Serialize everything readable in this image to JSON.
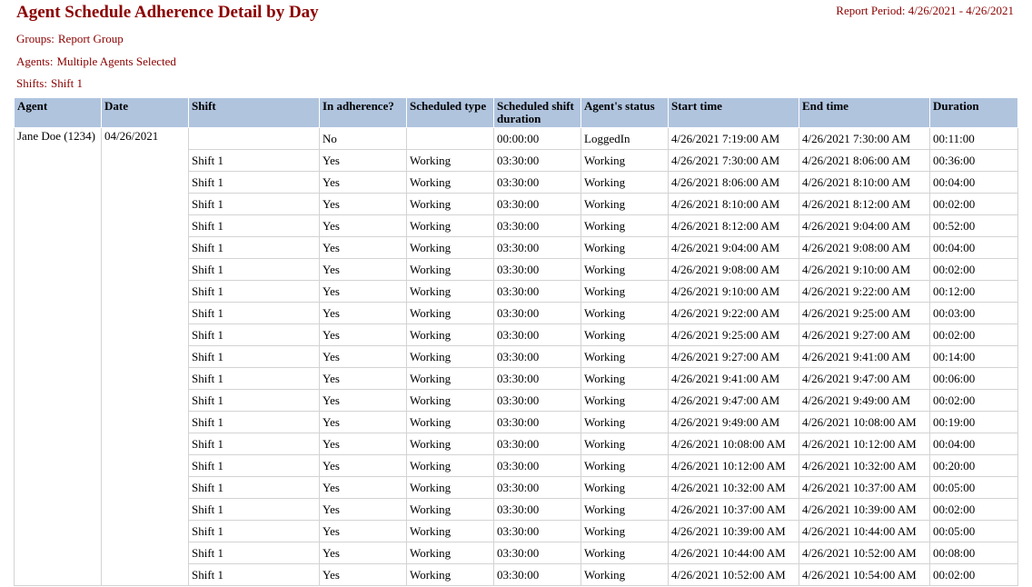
{
  "report": {
    "title": "Agent Schedule Adherence Detail by Day",
    "period_label": "Report Period:",
    "period_value": "4/26/2021 - 4/26/2021",
    "groups_label": "Groups:",
    "groups_value": "Report Group",
    "agents_label": "Agents:",
    "agents_value": "Multiple Agents Selected",
    "shifts_label": "Shifts:",
    "shifts_value": "Shift 1"
  },
  "table": {
    "headers": [
      "Agent",
      "Date",
      "Shift",
      "In adherence?",
      "Scheduled type",
      "Scheduled shift duration",
      "Agent's status",
      "Start time",
      "End time",
      "Duration"
    ],
    "agent": "Jane Doe (1234)",
    "date": "04/26/2021",
    "rows": [
      {
        "shift": "",
        "adherence": "No",
        "type": "",
        "sched_duration": "00:00:00",
        "status": "LoggedIn",
        "start": "4/26/2021 7:19:00 AM",
        "end": "4/26/2021 7:30:00 AM",
        "duration": "00:11:00"
      },
      {
        "shift": "Shift 1",
        "adherence": "Yes",
        "type": "Working",
        "sched_duration": "03:30:00",
        "status": "Working",
        "start": "4/26/2021 7:30:00 AM",
        "end": "4/26/2021 8:06:00 AM",
        "duration": "00:36:00"
      },
      {
        "shift": "Shift 1",
        "adherence": "Yes",
        "type": "Working",
        "sched_duration": "03:30:00",
        "status": "Working",
        "start": "4/26/2021 8:06:00 AM",
        "end": "4/26/2021 8:10:00 AM",
        "duration": "00:04:00"
      },
      {
        "shift": "Shift 1",
        "adherence": "Yes",
        "type": "Working",
        "sched_duration": "03:30:00",
        "status": "Working",
        "start": "4/26/2021 8:10:00 AM",
        "end": "4/26/2021 8:12:00 AM",
        "duration": "00:02:00"
      },
      {
        "shift": "Shift 1",
        "adherence": "Yes",
        "type": "Working",
        "sched_duration": "03:30:00",
        "status": "Working",
        "start": "4/26/2021 8:12:00 AM",
        "end": "4/26/2021 9:04:00 AM",
        "duration": "00:52:00"
      },
      {
        "shift": "Shift 1",
        "adherence": "Yes",
        "type": "Working",
        "sched_duration": "03:30:00",
        "status": "Working",
        "start": "4/26/2021 9:04:00 AM",
        "end": "4/26/2021 9:08:00 AM",
        "duration": "00:04:00"
      },
      {
        "shift": "Shift 1",
        "adherence": "Yes",
        "type": "Working",
        "sched_duration": "03:30:00",
        "status": "Working",
        "start": "4/26/2021 9:08:00 AM",
        "end": "4/26/2021 9:10:00 AM",
        "duration": "00:02:00"
      },
      {
        "shift": "Shift 1",
        "adherence": "Yes",
        "type": "Working",
        "sched_duration": "03:30:00",
        "status": "Working",
        "start": "4/26/2021 9:10:00 AM",
        "end": "4/26/2021 9:22:00 AM",
        "duration": "00:12:00"
      },
      {
        "shift": "Shift 1",
        "adherence": "Yes",
        "type": "Working",
        "sched_duration": "03:30:00",
        "status": "Working",
        "start": "4/26/2021 9:22:00 AM",
        "end": "4/26/2021 9:25:00 AM",
        "duration": "00:03:00"
      },
      {
        "shift": "Shift 1",
        "adherence": "Yes",
        "type": "Working",
        "sched_duration": "03:30:00",
        "status": "Working",
        "start": "4/26/2021 9:25:00 AM",
        "end": "4/26/2021 9:27:00 AM",
        "duration": "00:02:00"
      },
      {
        "shift": "Shift 1",
        "adherence": "Yes",
        "type": "Working",
        "sched_duration": "03:30:00",
        "status": "Working",
        "start": "4/26/2021 9:27:00 AM",
        "end": "4/26/2021 9:41:00 AM",
        "duration": "00:14:00"
      },
      {
        "shift": "Shift 1",
        "adherence": "Yes",
        "type": "Working",
        "sched_duration": "03:30:00",
        "status": "Working",
        "start": "4/26/2021 9:41:00 AM",
        "end": "4/26/2021 9:47:00 AM",
        "duration": "00:06:00"
      },
      {
        "shift": "Shift 1",
        "adherence": "Yes",
        "type": "Working",
        "sched_duration": "03:30:00",
        "status": "Working",
        "start": "4/26/2021 9:47:00 AM",
        "end": "4/26/2021 9:49:00 AM",
        "duration": "00:02:00"
      },
      {
        "shift": "Shift 1",
        "adherence": "Yes",
        "type": "Working",
        "sched_duration": "03:30:00",
        "status": "Working",
        "start": "4/26/2021 9:49:00 AM",
        "end": "4/26/2021 10:08:00 AM",
        "duration": "00:19:00"
      },
      {
        "shift": "Shift 1",
        "adherence": "Yes",
        "type": "Working",
        "sched_duration": "03:30:00",
        "status": "Working",
        "start": "4/26/2021 10:08:00 AM",
        "end": "4/26/2021 10:12:00 AM",
        "duration": "00:04:00"
      },
      {
        "shift": "Shift 1",
        "adherence": "Yes",
        "type": "Working",
        "sched_duration": "03:30:00",
        "status": "Working",
        "start": "4/26/2021 10:12:00 AM",
        "end": "4/26/2021 10:32:00 AM",
        "duration": "00:20:00"
      },
      {
        "shift": "Shift 1",
        "adherence": "Yes",
        "type": "Working",
        "sched_duration": "03:30:00",
        "status": "Working",
        "start": "4/26/2021 10:32:00 AM",
        "end": "4/26/2021 10:37:00 AM",
        "duration": "00:05:00"
      },
      {
        "shift": "Shift 1",
        "adherence": "Yes",
        "type": "Working",
        "sched_duration": "03:30:00",
        "status": "Working",
        "start": "4/26/2021 10:37:00 AM",
        "end": "4/26/2021 10:39:00 AM",
        "duration": "00:02:00"
      },
      {
        "shift": "Shift 1",
        "adherence": "Yes",
        "type": "Working",
        "sched_duration": "03:30:00",
        "status": "Working",
        "start": "4/26/2021 10:39:00 AM",
        "end": "4/26/2021 10:44:00 AM",
        "duration": "00:05:00"
      },
      {
        "shift": "Shift 1",
        "adherence": "Yes",
        "type": "Working",
        "sched_duration": "03:30:00",
        "status": "Working",
        "start": "4/26/2021 10:44:00 AM",
        "end": "4/26/2021 10:52:00 AM",
        "duration": "00:08:00"
      },
      {
        "shift": "Shift 1",
        "adherence": "Yes",
        "type": "Working",
        "sched_duration": "03:30:00",
        "status": "Working",
        "start": "4/26/2021 10:52:00 AM",
        "end": "4/26/2021 10:54:00 AM",
        "duration": "00:02:00"
      }
    ]
  }
}
